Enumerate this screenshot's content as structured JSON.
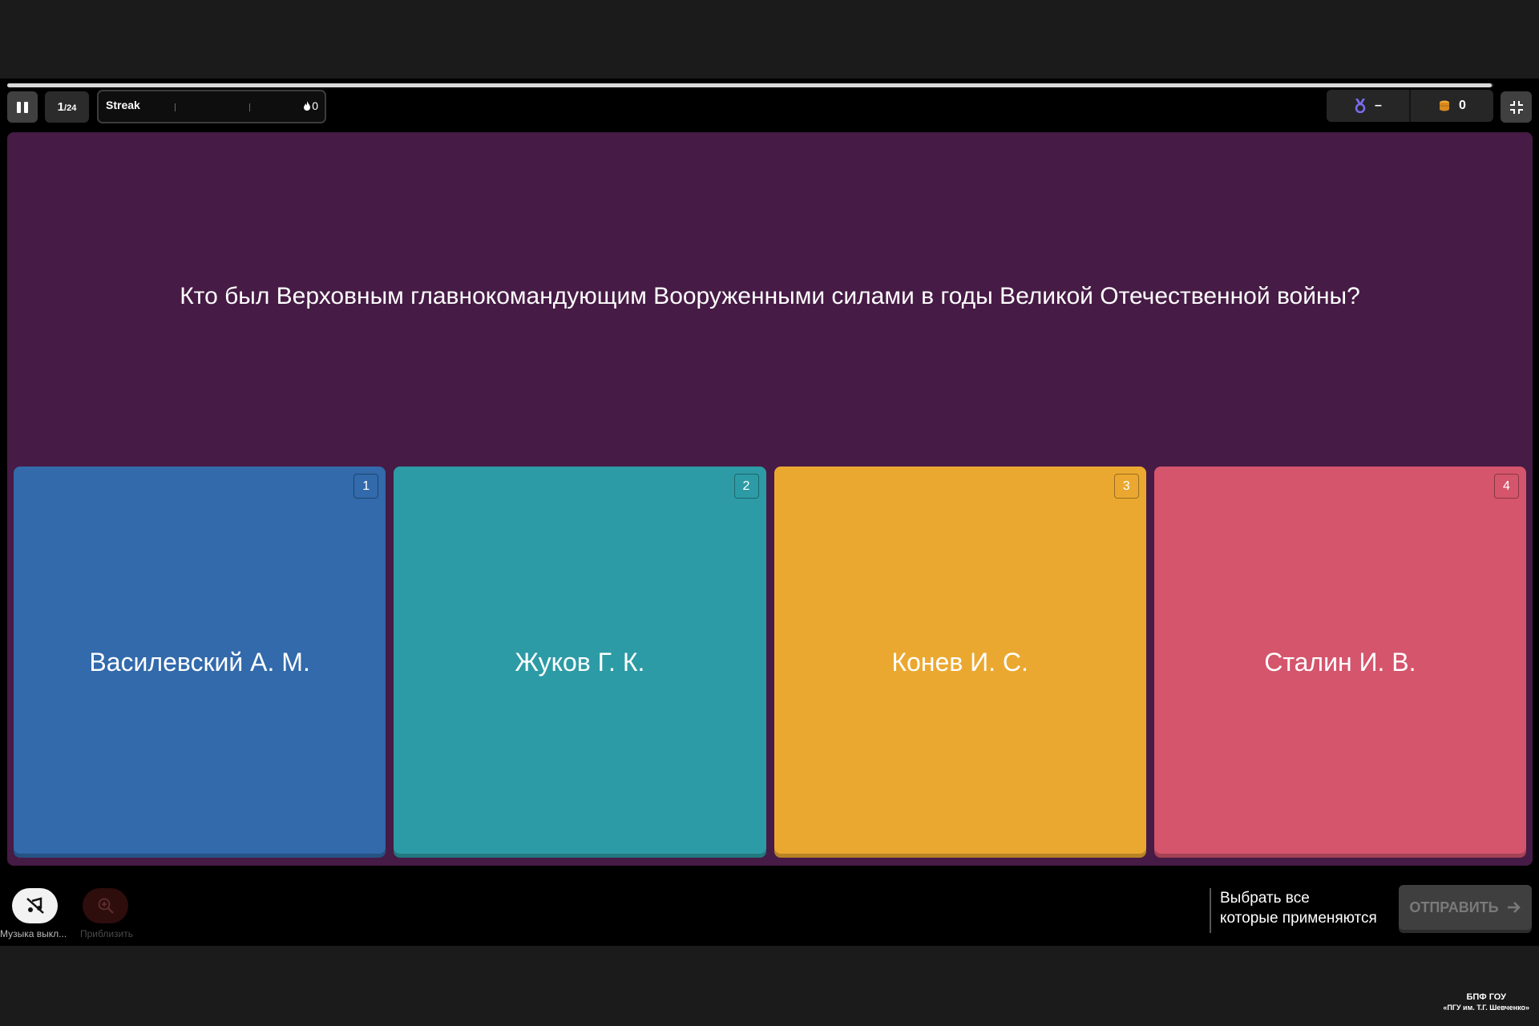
{
  "progress": {
    "current": 1,
    "total": 24
  },
  "topbar": {
    "counter_current": "1",
    "counter_total": "/24",
    "streak_label": "Streak",
    "streak_count": "0",
    "rank_value": "–",
    "coins_value": "0"
  },
  "question": {
    "text": "Кто был Верховным главнокомандующим Вооруженными силами в годы Великой Отечественной войны?"
  },
  "answers": [
    {
      "number": "1",
      "label": "Василевский А. М.",
      "color": "#326aab"
    },
    {
      "number": "2",
      "label": "Жуков Г. К.",
      "color": "#2d9ba5"
    },
    {
      "number": "3",
      "label": "Конев И. С.",
      "color": "#eba830"
    },
    {
      "number": "4",
      "label": "Сталин И. В.",
      "color": "#d4556c"
    }
  ],
  "bottom": {
    "music_label": "Музыка выкл...",
    "zoom_label": "Приблизить",
    "hint_line1": "Выбрать все",
    "hint_line2": "которые применяются",
    "submit_label": "ОТПРАВИТЬ"
  },
  "watermark": {
    "line1": "БПФ ГОУ",
    "line2": "«ПГУ им. Т.Г. Шевченко»"
  },
  "colors": {
    "question_bg": "#461b45",
    "page_bg": "#1b1b1b",
    "stage_bg": "#000000"
  }
}
